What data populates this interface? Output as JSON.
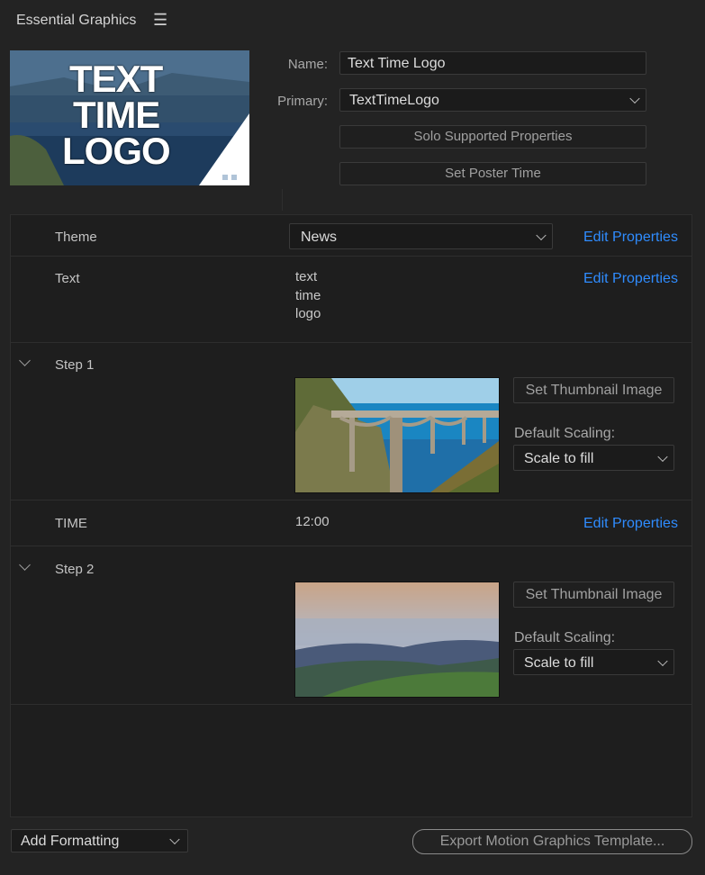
{
  "panel": {
    "title": "Essential Graphics"
  },
  "poster": {
    "line1": "TEXT",
    "line2": "TIME",
    "line3": "LOGO"
  },
  "name": {
    "label": "Name:",
    "value": "Text Time Logo"
  },
  "primary": {
    "label": "Primary:",
    "value": "TextTimeLogo"
  },
  "buttons": {
    "solo": "Solo Supported Properties",
    "poster_time": "Set Poster Time"
  },
  "rows": {
    "theme": {
      "label": "Theme",
      "value": "News",
      "edit": "Edit Properties"
    },
    "text": {
      "label": "Text",
      "lines": [
        "text",
        "time",
        "logo"
      ],
      "edit": "Edit Properties"
    },
    "step1": {
      "label": "Step 1",
      "set_thumb": "Set Thumbnail Image",
      "scaling_label": "Default Scaling:",
      "scaling_value": "Scale to fill"
    },
    "time": {
      "label": "TIME",
      "value": "12:00",
      "edit": "Edit Properties"
    },
    "step2": {
      "label": "Step 2",
      "set_thumb": "Set Thumbnail Image",
      "scaling_label": "Default Scaling:",
      "scaling_value": "Scale to fill"
    }
  },
  "footer": {
    "add_formatting": "Add Formatting",
    "export": "Export Motion Graphics Template..."
  },
  "colors": {
    "accent": "#2f8cff",
    "background": "#232323"
  },
  "icons": {
    "menu": "hamburger-icon",
    "dropdown": "chevron-down-icon",
    "expand": "disclosure-triangle-icon"
  }
}
